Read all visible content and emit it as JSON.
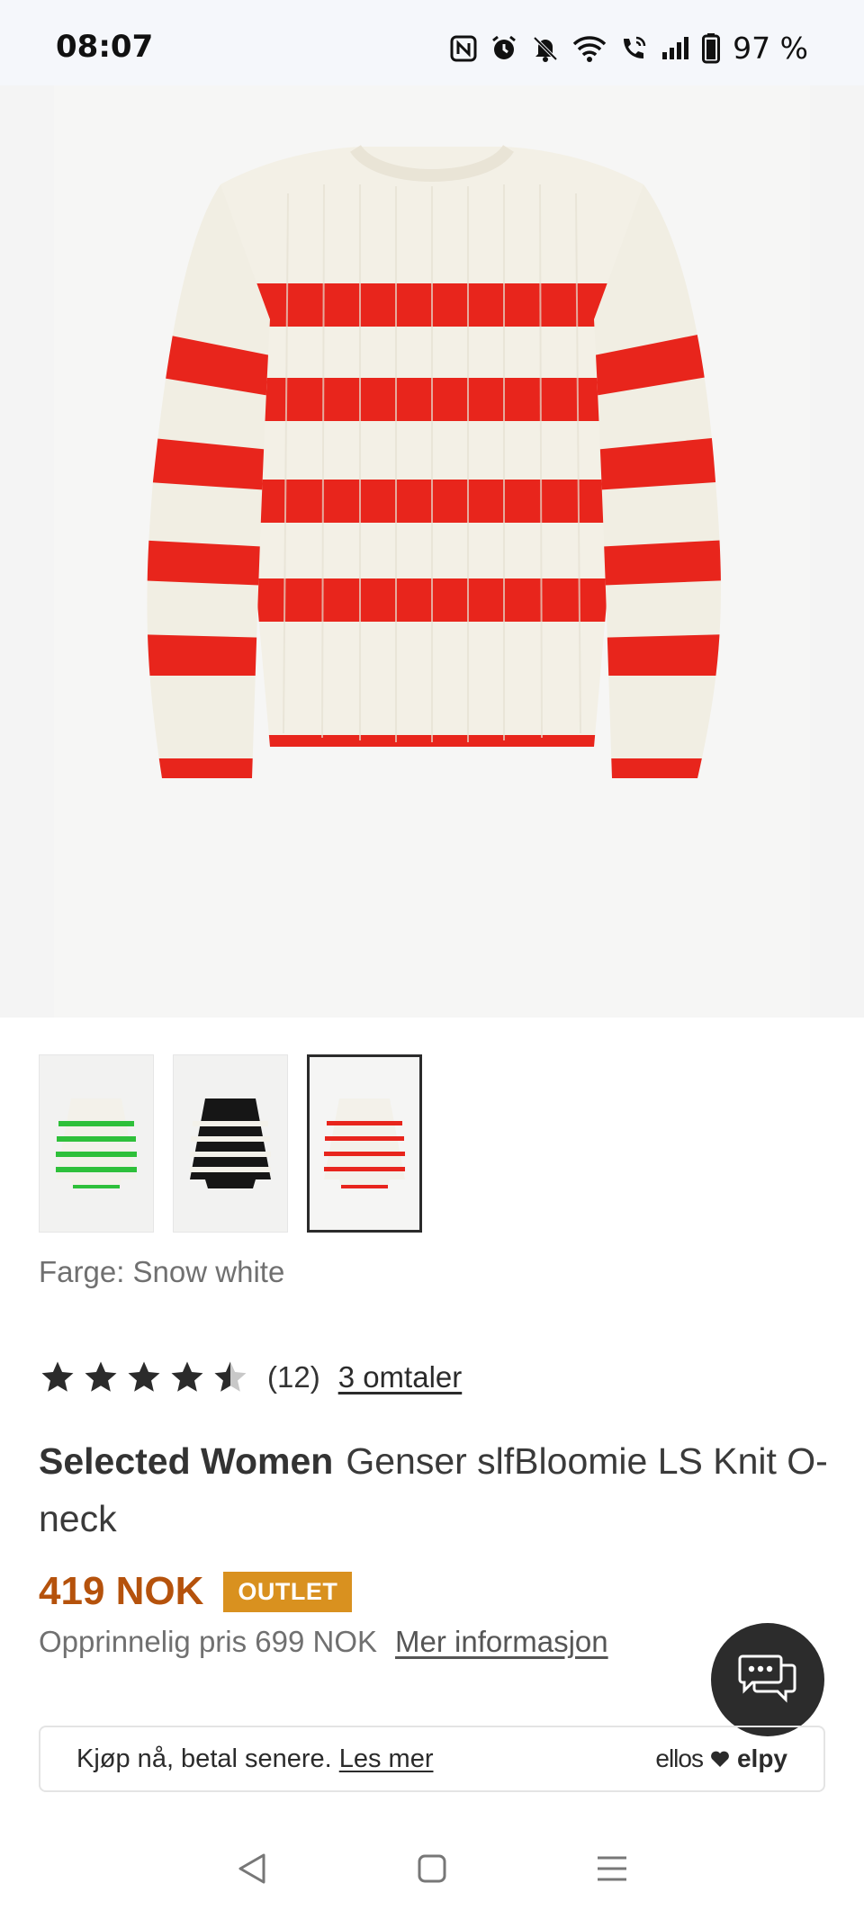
{
  "status_bar": {
    "time": "08:07",
    "battery_percent": "97 %",
    "icons": [
      "nfc-icon",
      "alarm-icon",
      "mute-icon",
      "wifi-icon",
      "wifi-calling-icon",
      "signal-icon",
      "battery-icon"
    ]
  },
  "product": {
    "color_label": "Farge: Snow white",
    "rating_count": "(12)",
    "reviews_link": "3 omtaler",
    "rating_value": 4.5,
    "brand": "Selected Women",
    "name": "Genser slfBloomie LS Knit O-neck",
    "price": "419 NOK",
    "badge": "OUTLET",
    "original_price": "Opprinnelig pris 699 NOK",
    "more_info": "Mer informasjon"
  },
  "thumbnails": [
    {
      "stripe_color": "#2ec03a",
      "base_color": "#f3f1ea",
      "selected": false
    },
    {
      "stripe_color": "#f3f1ea",
      "base_color": "#161616",
      "selected": false
    },
    {
      "stripe_color": "#e8251c",
      "base_color": "#f3f1ea",
      "selected": true
    }
  ],
  "bnpl": {
    "text": "Kjøp nå, betal senere.",
    "link": "Les mer",
    "logo_left": "ellos",
    "logo_right": "elpy"
  },
  "colors": {
    "price": "#b5520c",
    "badge": "#d9911f",
    "stripe": "#e8251c",
    "knit": "#f3f0e6"
  }
}
